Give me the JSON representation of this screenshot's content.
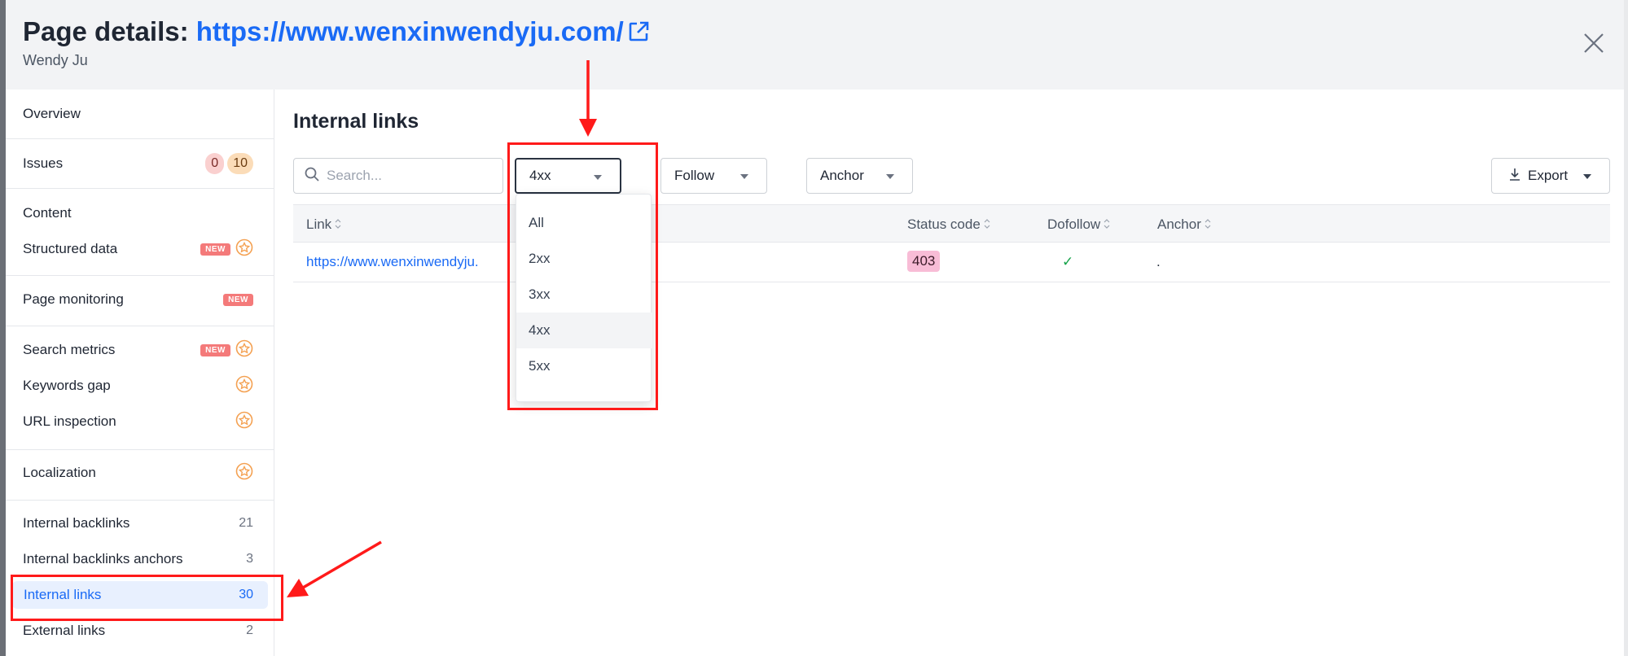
{
  "header": {
    "title_prefix": "Page details:",
    "url": "https://www.wenxinwendyju.com/",
    "subtitle": "Wendy Ju"
  },
  "sidebar": {
    "overview": "Overview",
    "issues": {
      "label": "Issues",
      "errors": "0",
      "warnings": "10"
    },
    "content": "Content",
    "structured_data": "Structured data",
    "page_monitoring": "Page monitoring",
    "search_metrics": "Search metrics",
    "keywords_gap": "Keywords gap",
    "url_inspection": "URL inspection",
    "localization": "Localization",
    "internal_backlinks": {
      "label": "Internal backlinks",
      "count": "21"
    },
    "internal_backlinks_anchors": {
      "label": "Internal backlinks anchors",
      "count": "3"
    },
    "internal_links": {
      "label": "Internal links",
      "count": "30"
    },
    "external_links": {
      "label": "External links",
      "count": "2"
    },
    "new_badge": "NEW"
  },
  "main": {
    "title": "Internal links",
    "search_placeholder": "Search...",
    "status_filter": "4xx",
    "follow_filter": "Follow",
    "anchor_filter": "Anchor",
    "export": "Export",
    "columns": {
      "link": "Link",
      "status_code": "Status code",
      "dofollow": "Dofollow",
      "anchor": "Anchor"
    },
    "rows": [
      {
        "link": "https://www.wenxinwendyju.",
        "status_code": "403",
        "dofollow": "✓",
        "anchor": "."
      }
    ]
  },
  "status_menu": {
    "options": [
      "All",
      "2xx",
      "3xx",
      "4xx",
      "5xx"
    ],
    "highlighted": "4xx"
  },
  "colors": {
    "accent": "#1a6af5",
    "annotation": "#ff1a1a",
    "status_4xx_badge": "#f8bcd6",
    "dofollow_check": "#16a34a"
  }
}
